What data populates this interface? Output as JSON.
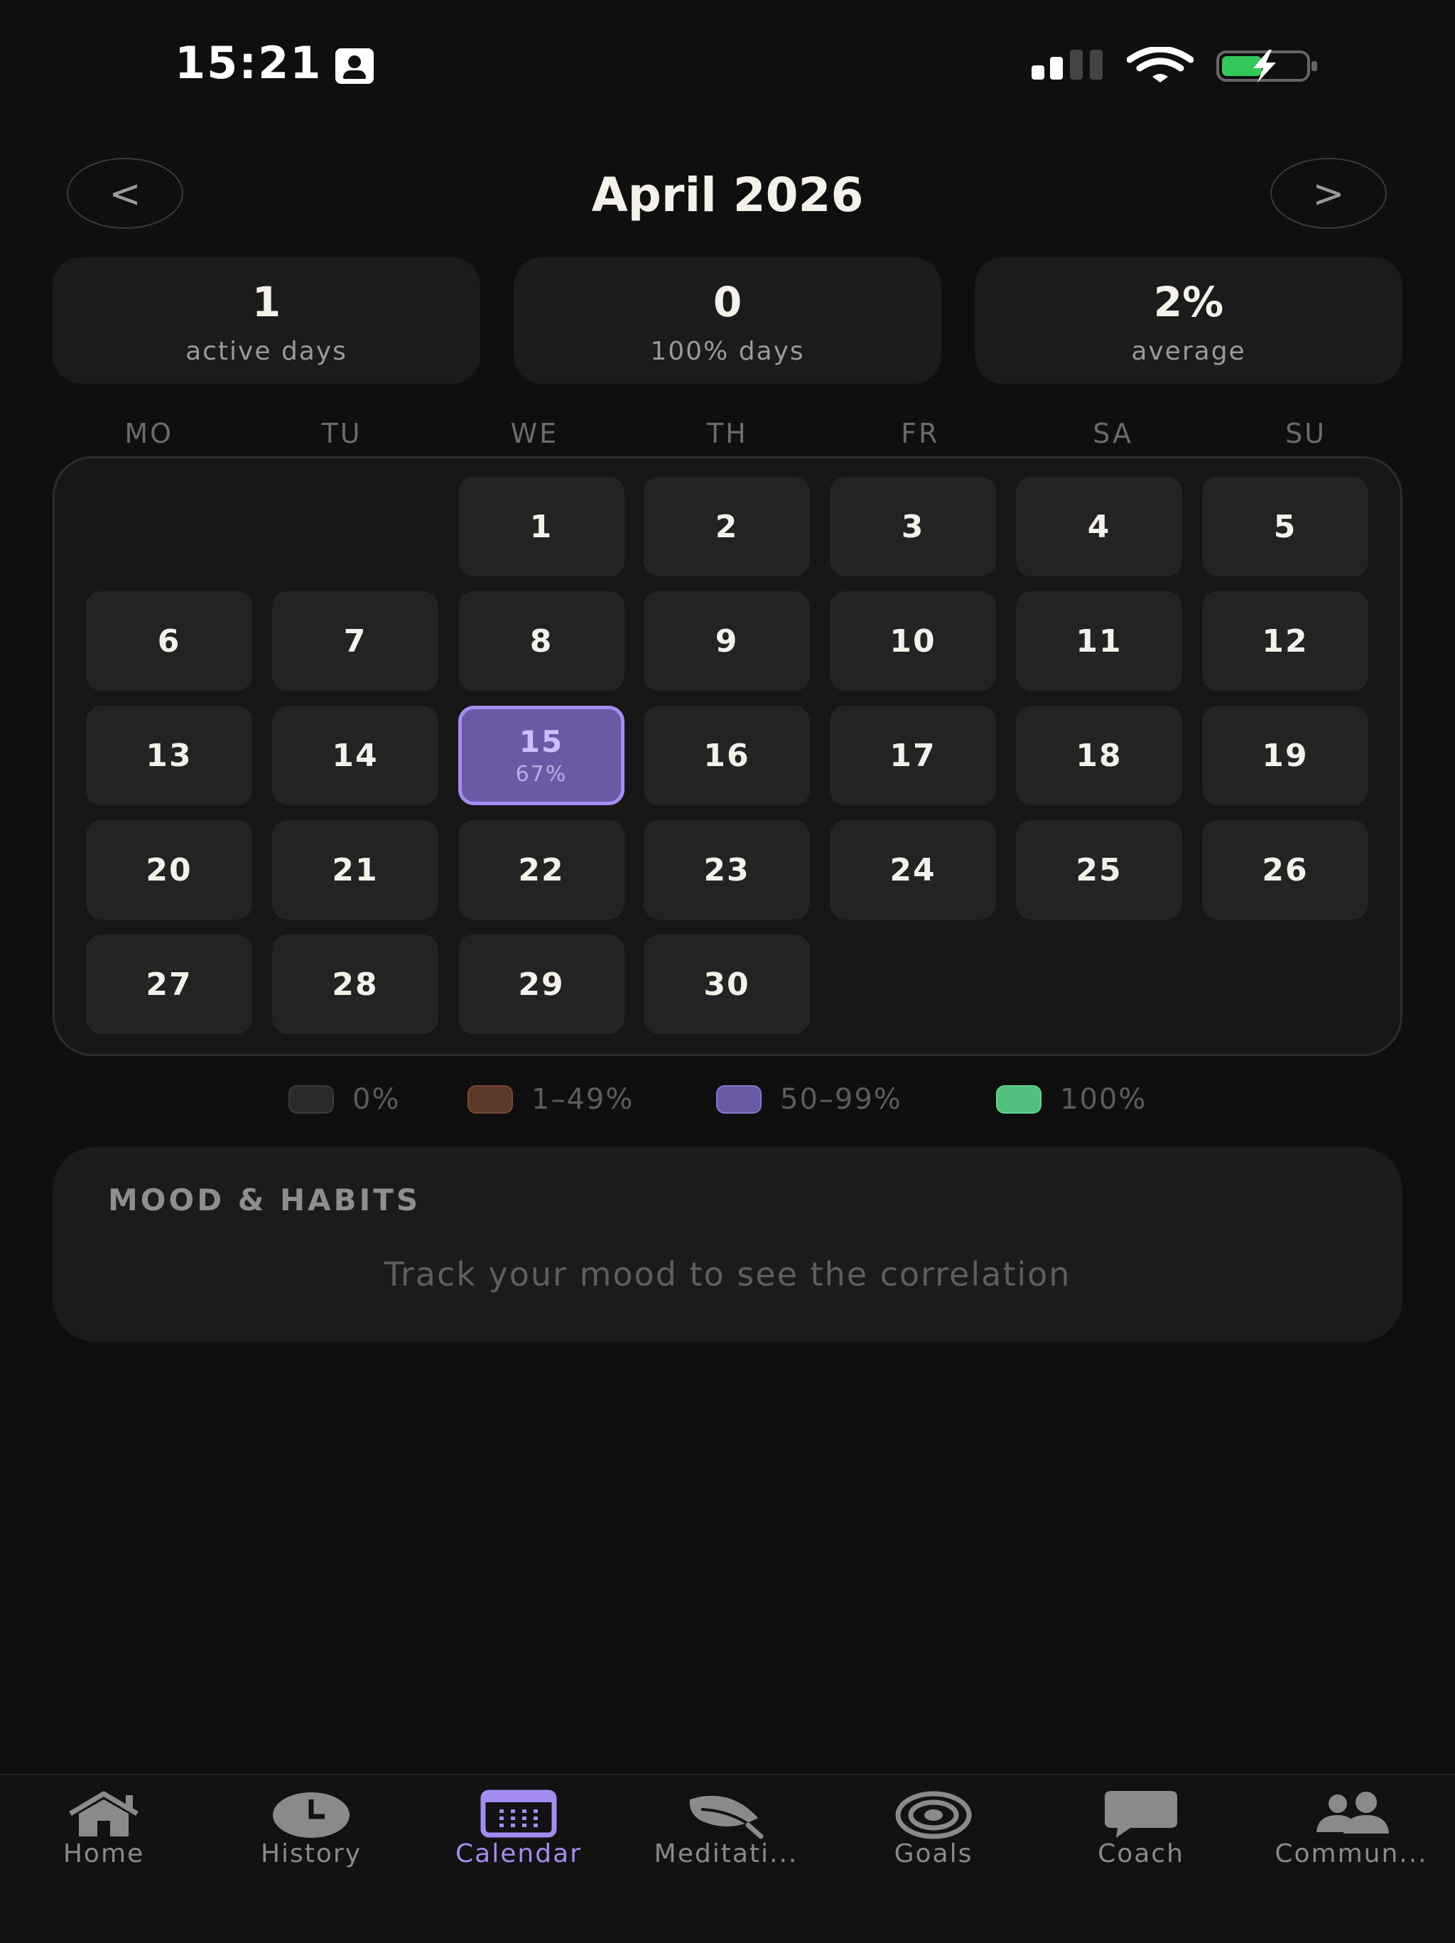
{
  "status_bar": {
    "time": "15:21"
  },
  "header": {
    "prev": "<",
    "next": ">",
    "title": "April 2026"
  },
  "stats": [
    {
      "value": "1",
      "label": "active days"
    },
    {
      "value": "0",
      "label": "100% days"
    },
    {
      "value": "2%",
      "label": "average"
    }
  ],
  "weekdays": [
    "MO",
    "TU",
    "WE",
    "TH",
    "FR",
    "SA",
    "SU"
  ],
  "calendar": {
    "days": [
      "1",
      "2",
      "3",
      "4",
      "5",
      "6",
      "7",
      "8",
      "9",
      "10",
      "11",
      "12",
      "13",
      "14",
      "15",
      "16",
      "17",
      "18",
      "19",
      "20",
      "21",
      "22",
      "23",
      "24",
      "25",
      "26",
      "27",
      "28",
      "29",
      "30"
    ],
    "today": {
      "day": "15",
      "percent": "67%"
    }
  },
  "legend": [
    {
      "label": "0%",
      "color": "#2a2a2a"
    },
    {
      "label": "1–49%",
      "color": "#5c3828"
    },
    {
      "label": "50–99%",
      "color": "#6a5aa6"
    },
    {
      "label": "100%",
      "color": "#4fc07e"
    }
  ],
  "mood": {
    "title": "MOOD & HABITS",
    "message": "Track your mood to see the correlation"
  },
  "tabs": [
    {
      "label": "Home",
      "icon": "home-icon"
    },
    {
      "label": "History",
      "icon": "clock-icon"
    },
    {
      "label": "Calendar",
      "icon": "calendar-icon"
    },
    {
      "label": "Meditati...",
      "icon": "leaf-icon"
    },
    {
      "label": "Goals",
      "icon": "target-icon"
    },
    {
      "label": "Coach",
      "icon": "chat-bubble-icon"
    },
    {
      "label": "Commun...",
      "icon": "people-icon"
    }
  ],
  "colors": {
    "accent": "#a58cf0",
    "background": "#0f0f0f",
    "card": "#1b1b1b"
  }
}
